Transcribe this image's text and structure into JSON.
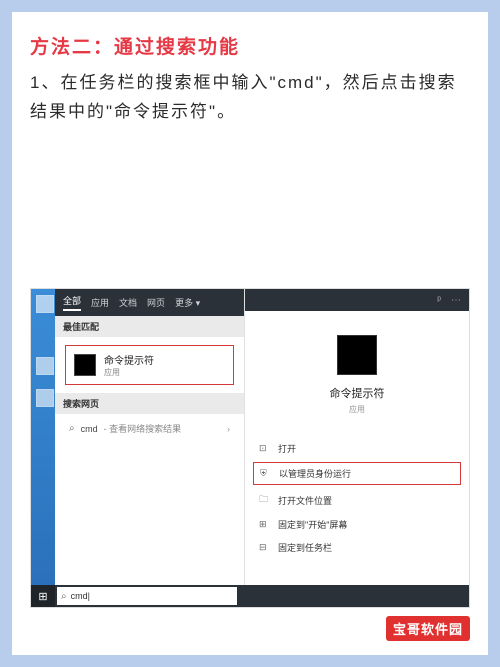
{
  "heading": "方法二：通过搜索功能",
  "instruction": "1、在任务栏的搜索框中输入\"cmd\"，然后点击搜索结果中的\"命令提示符\"。",
  "tabs": {
    "all": "全部",
    "apps": "应用",
    "docs": "文档",
    "web": "网页",
    "more": "更多 ▾"
  },
  "section": {
    "best_match": "最佳匹配",
    "search_web": "搜索网页"
  },
  "best_match": {
    "name": "命令提示符",
    "sub": "应用"
  },
  "web_result": {
    "query": "cmd",
    "desc": "- 查看网络搜索结果"
  },
  "detail": {
    "name": "命令提示符",
    "sub": "应用"
  },
  "actions": {
    "open": "打开",
    "admin": "以管理员身份运行",
    "file_loc": "打开文件位置",
    "pin_start": "固定到\"开始\"屏幕",
    "pin_taskbar": "固定到任务栏"
  },
  "taskbar": {
    "search_text": "cmd"
  },
  "watermark": "宝哥软件园"
}
